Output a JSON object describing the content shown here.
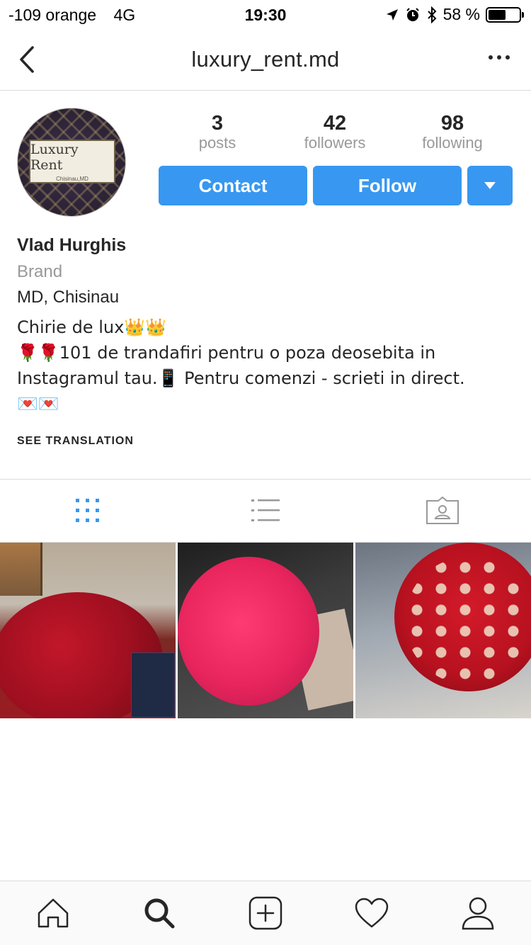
{
  "status_bar": {
    "signal": "-109 orange",
    "network": "4G",
    "time": "19:30",
    "battery_percent": "58 %",
    "battery_level": 0.58
  },
  "header": {
    "username": "luxury_rent.md",
    "back_icon": "chevron-left-icon",
    "more_icon": "more-horizontal-icon"
  },
  "avatar": {
    "brand_text": "Luxury Rent",
    "city_text": "Chisinau,MD"
  },
  "stats": [
    {
      "value": "3",
      "label": "posts"
    },
    {
      "value": "42",
      "label": "followers"
    },
    {
      "value": "98",
      "label": "following"
    }
  ],
  "actions": {
    "contact_label": "Contact",
    "follow_label": "Follow",
    "accent_color": "#3897f0"
  },
  "bio": {
    "name": "Vlad Hurghis",
    "category": "Brand",
    "location": "MD, Chisinau",
    "line1": "Chirie de lux👑👑",
    "line2": "🌹🌹101 de trandafiri pentru o poza deosebita in",
    "line3": "Instagramul tau.📱 Pentru comenzi - scrieti in direct.",
    "line4": "💌💌",
    "see_translation": "SEE TRANSLATION"
  },
  "view_tabs": [
    {
      "name": "grid",
      "icon": "grid-icon",
      "active": true
    },
    {
      "name": "list",
      "icon": "list-icon",
      "active": false
    },
    {
      "name": "tagged",
      "icon": "tagged-photos-icon",
      "active": false
    }
  ],
  "posts": [
    {
      "icon": "red-roses-photo"
    },
    {
      "icon": "pink-roses-car-photo"
    },
    {
      "icon": "red-white-roses-car-photo"
    }
  ],
  "tab_bar": [
    {
      "name": "home",
      "icon": "home-icon"
    },
    {
      "name": "search",
      "icon": "search-icon",
      "active": true
    },
    {
      "name": "new-post",
      "icon": "plus-square-icon"
    },
    {
      "name": "activity",
      "icon": "heart-icon"
    },
    {
      "name": "profile",
      "icon": "person-icon"
    }
  ]
}
